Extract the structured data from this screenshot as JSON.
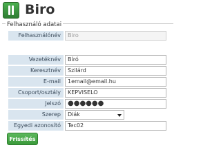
{
  "header": {
    "title": "Biro",
    "icon": "app-logo-icon"
  },
  "section": {
    "legend": "Felhasználó adatai"
  },
  "fields": {
    "username": {
      "label": "Felhasználónév",
      "value": "Biro"
    },
    "lastname": {
      "label": "Vezetéknév",
      "value": "Bíró"
    },
    "firstname": {
      "label": "Keresztnév",
      "value": "Szilárd"
    },
    "email": {
      "label": "E-mail",
      "value": "1email@email.hu"
    },
    "group": {
      "label": "Csoport/osztály",
      "value": "KEPVISELO"
    },
    "password": {
      "label": "Jelszó",
      "value": "●●●●●●"
    },
    "role": {
      "label": "Szerep",
      "value": "Diák"
    },
    "identifier": {
      "label": "Egyedi azonosító",
      "value": "Tec02"
    }
  },
  "actions": {
    "refresh_label": "Frissítés"
  },
  "colors": {
    "label_bg": "#d9e5ef",
    "button": "#4cae4c"
  }
}
